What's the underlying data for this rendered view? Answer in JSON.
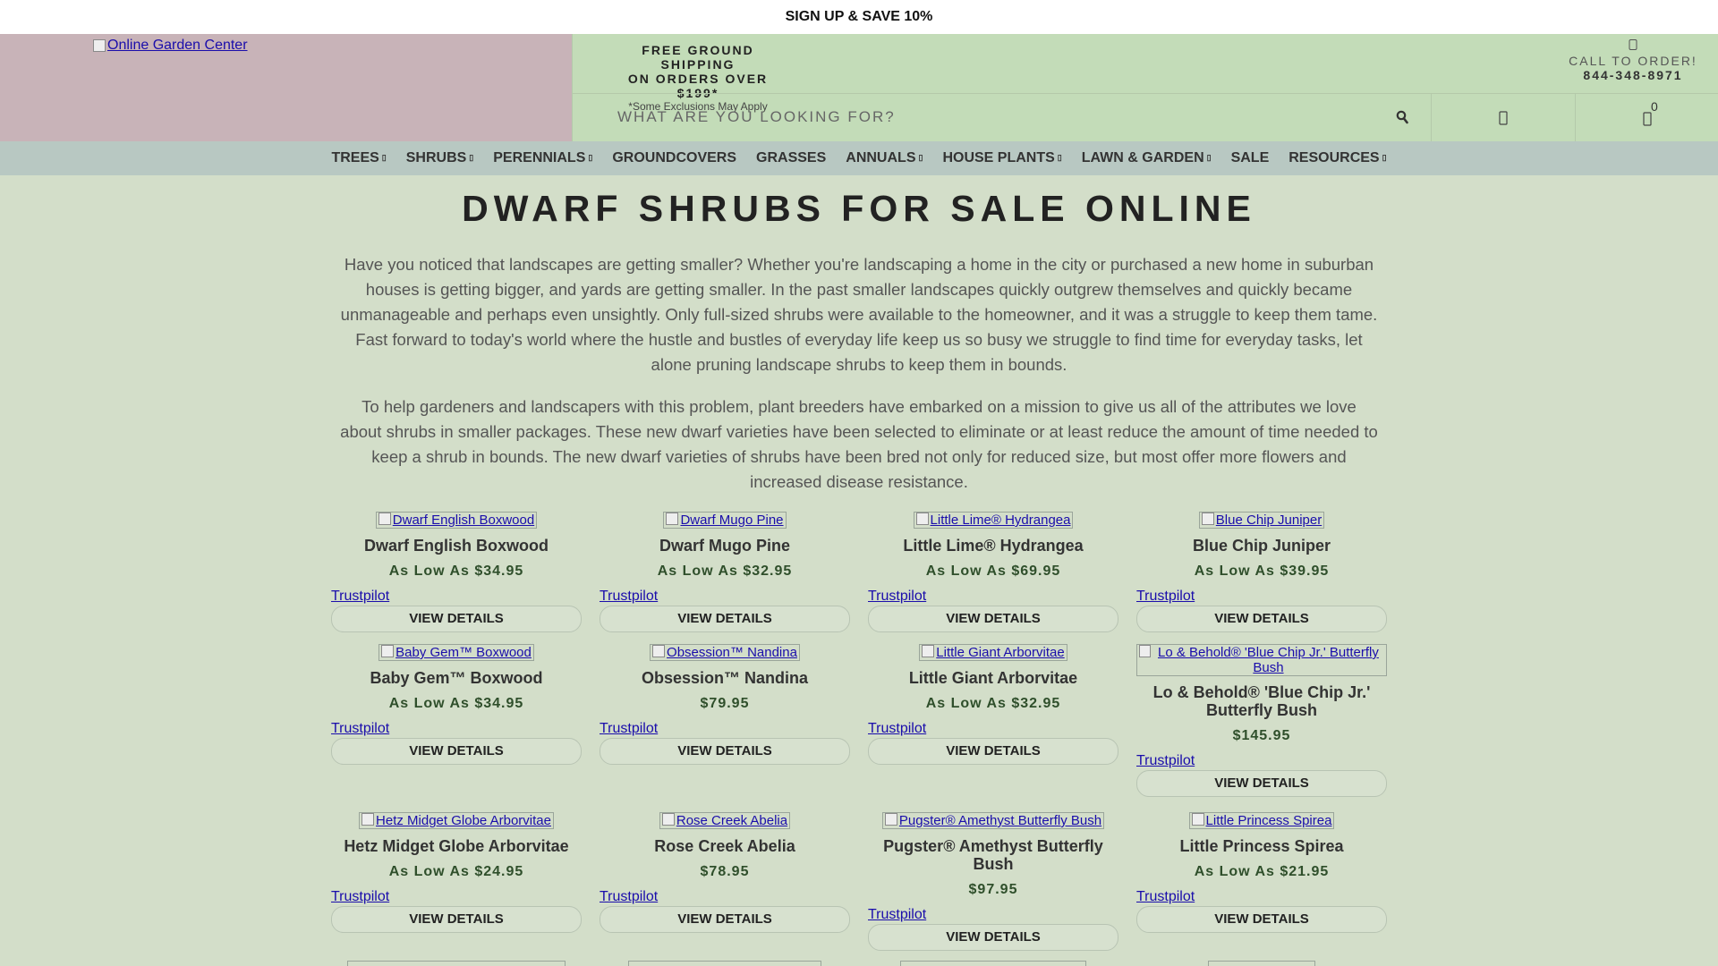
{
  "promo": {
    "text": "SIGN UP & SAVE 10%"
  },
  "header": {
    "logo_alt": "Online Garden Center",
    "shipping_line1": "FREE GROUND SHIPPING",
    "shipping_line2": "ON ORDERS OVER $199*",
    "shipping_note": "*Some Exclusions May Apply",
    "call_label": "CALL TO ORDER!",
    "call_phone": "844-348-8971",
    "search_placeholder": "WHAT ARE YOU LOOKING FOR?",
    "cart_count": "0",
    "icons": {
      "search": "search-icon",
      "account": "user-icon",
      "cart": "cart-icon",
      "phone": "phone-icon"
    }
  },
  "nav": {
    "items": [
      {
        "label": "TREES",
        "has_dropdown": true
      },
      {
        "label": "SHRUBS",
        "has_dropdown": true
      },
      {
        "label": "PERENNIALS",
        "has_dropdown": true
      },
      {
        "label": "GROUNDCOVERS",
        "has_dropdown": false
      },
      {
        "label": "GRASSES",
        "has_dropdown": false
      },
      {
        "label": "ANNUALS",
        "has_dropdown": true
      },
      {
        "label": "HOUSE PLANTS",
        "has_dropdown": true
      },
      {
        "label": "LAWN & GARDEN",
        "has_dropdown": true
      },
      {
        "label": "SALE",
        "has_dropdown": false
      },
      {
        "label": "RESOURCES",
        "has_dropdown": true
      }
    ]
  },
  "main": {
    "title": "DWARF SHRUBS FOR SALE ONLINE",
    "intro_1": "Have you noticed that landscapes are getting smaller? Whether you're landscaping a home in the city or purchased a new home in suburban houses is getting bigger, and yards are getting smaller. In the past smaller landscapes quickly outgrew themselves and quickly became unmanageable and perhaps even unsightly. Only full-sized shrubs were available to the homeowner, and it was a struggle to keep them tame. Fast forward to today's world where the hustle and bustles of everyday life keep us so busy we struggle to find time for everyday tasks, let alone pruning landscape shrubs to keep them in bounds.",
    "intro_2": "To help gardeners and landscapers with this problem, plant breeders have embarked on a mission to give us all of the attributes we love about shrubs in smaller packages. These new dwarf varieties have been selected to eliminate or at least reduce the amount of time needed to keep a shrub in bounds. The new dwarf varieties of shrubs have been bred not only for reduced size, but most offer more flowers and increased disease resistance."
  },
  "products": [
    {
      "img_alt": "Dwarf English Boxwood",
      "name": "Dwarf English Boxwood",
      "price": "As Low As $34.95",
      "trust": "Trustpilot",
      "button": "VIEW DETAILS"
    },
    {
      "img_alt": "Dwarf Mugo Pine",
      "name": "Dwarf Mugo Pine",
      "price": "As Low As $32.95",
      "trust": "Trustpilot",
      "button": "VIEW DETAILS"
    },
    {
      "img_alt": "Little Lime® Hydrangea",
      "name": "Little Lime® Hydrangea",
      "price": "As Low As $69.95",
      "trust": "Trustpilot",
      "button": "VIEW DETAILS"
    },
    {
      "img_alt": "Blue Chip Juniper",
      "name": "Blue Chip Juniper",
      "price": "As Low As $39.95",
      "trust": "Trustpilot",
      "button": "VIEW DETAILS"
    },
    {
      "img_alt": "Baby Gem™ Boxwood",
      "name": "Baby Gem™ Boxwood",
      "price": "As Low As $34.95",
      "trust": "Trustpilot",
      "button": "VIEW DETAILS"
    },
    {
      "img_alt": "Obsession™ Nandina",
      "name": "Obsession™ Nandina",
      "price": "$79.95",
      "trust": "Trustpilot",
      "button": "VIEW DETAILS"
    },
    {
      "img_alt": "Little Giant Arborvitae",
      "name": "Little Giant Arborvitae",
      "price": "As Low As $32.95",
      "trust": "Trustpilot",
      "button": "VIEW DETAILS"
    },
    {
      "img_alt": "Lo & Behold® 'Blue Chip Jr.' Butterfly Bush",
      "name": "Lo & Behold® 'Blue Chip Jr.' Butterfly Bush",
      "price": "$145.95",
      "trust": "Trustpilot",
      "button": "VIEW DETAILS"
    },
    {
      "img_alt": "Hetz Midget Globe Arborvitae",
      "name": "Hetz Midget Globe Arborvitae",
      "price": "As Low As $24.95",
      "trust": "Trustpilot",
      "button": "VIEW DETAILS"
    },
    {
      "img_alt": "Rose Creek Abelia",
      "name": "Rose Creek Abelia",
      "price": "$78.95",
      "trust": "Trustpilot",
      "button": "VIEW DETAILS"
    },
    {
      "img_alt": "Pugster® Amethyst Butterfly Bush",
      "name": "Pugster® Amethyst Butterfly Bush",
      "price": "$97.95",
      "trust": "Trustpilot",
      "button": "VIEW DETAILS"
    },
    {
      "img_alt": "Little Princess Spirea",
      "name": "Little Princess Spirea",
      "price": "As Low As $21.95",
      "trust": "Trustpilot",
      "button": "VIEW DETAILS"
    }
  ],
  "colors": {
    "page_bg": "#d3dec9",
    "logo_bg": "#c8b3b8",
    "header_bg": "#c3dcb8",
    "nav_bg": "#b8c8c2",
    "price": "#2f4f2b",
    "link": "#1a0dab"
  }
}
